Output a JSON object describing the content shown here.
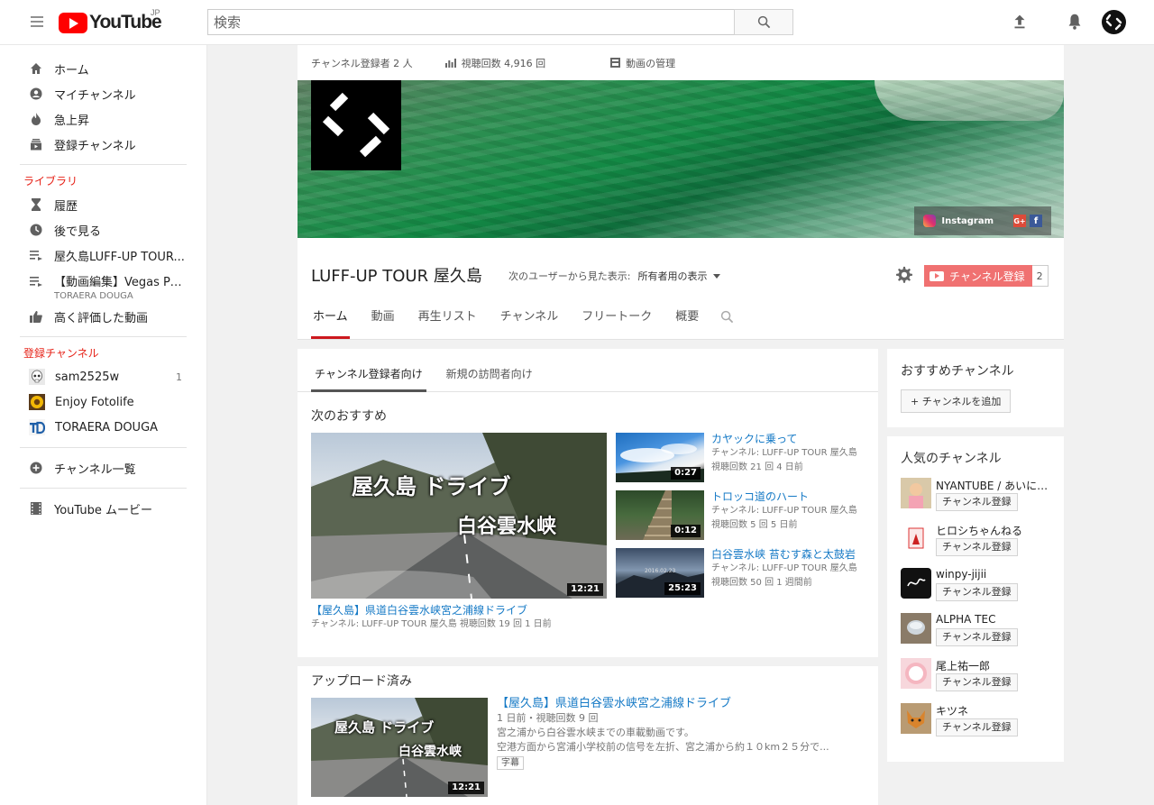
{
  "header": {
    "logo_text": "YouTube",
    "country": "JP",
    "search_placeholder": "検索"
  },
  "sidebar": {
    "main": [
      {
        "label": "ホーム",
        "icon": "home-icon"
      },
      {
        "label": "マイチャンネル",
        "icon": "account-icon"
      },
      {
        "label": "急上昇",
        "icon": "flame-icon"
      },
      {
        "label": "登録チャンネル",
        "icon": "subscriptions-icon"
      }
    ],
    "library_heading": "ライブラリ",
    "library": [
      {
        "label": "履歴",
        "icon": "hourglass-icon"
      },
      {
        "label": "後で見る",
        "icon": "clock-icon"
      },
      {
        "label": "屋久島LUFF-UP TOUR...",
        "icon": "playlist-icon"
      },
      {
        "label": "【動画編集】Vegas Pr...",
        "sub": "TORAERA DOUGA",
        "icon": "playlist-icon"
      },
      {
        "label": "高く評価した動画",
        "icon": "thumbs-up-icon"
      }
    ],
    "subs_heading": "登録チャンネル",
    "subscriptions": [
      {
        "label": "sam2525w",
        "count": "1"
      },
      {
        "label": "Enjoy Fotolife",
        "count": ""
      },
      {
        "label": "TORAERA DOUGA",
        "count": ""
      }
    ],
    "browse_channels": "チャンネル一覧",
    "movies": "YouTube ムービー"
  },
  "channel": {
    "stats": {
      "subscribers": "チャンネル登録者 2 人",
      "views": "視聴回数 4,916 回",
      "manage": "動画の管理"
    },
    "social": {
      "instagram": "Instagram",
      "google": "G+",
      "facebook": "f"
    },
    "title": "LUFF-UP TOUR 屋久島",
    "view_as_label": "次のユーザーから見た表示:",
    "view_as_value": "所有者用の表示",
    "subscribe_label": "チャンネル登録",
    "subscribe_count": "2",
    "tabs": [
      "ホーム",
      "動画",
      "再生リスト",
      "チャンネル",
      "フリートーク",
      "概要"
    ]
  },
  "content": {
    "sub_tabs": [
      "チャンネル登録者向け",
      "新規の訪問者向け"
    ],
    "next_title": "次のおすすめ",
    "featured": {
      "thumb_text_1": "屋久島 ドライブ",
      "thumb_text_2": "白谷雲水峡",
      "duration": "12:21",
      "title": "【屋久島】県道白谷雲水峡宮之浦線ドライブ",
      "meta": "チャンネル: LUFF-UP TOUR 屋久島   視聴回数 19 回   1 日前"
    },
    "side_videos": [
      {
        "title": "カヤックに乗って",
        "channel": "チャンネル: LUFF-UP TOUR 屋久島",
        "meta": "視聴回数 21 回   4 日前",
        "duration": "0:27"
      },
      {
        "title": "トロッコ道のハート",
        "channel": "チャンネル: LUFF-UP TOUR 屋久島",
        "meta": "視聴回数 5 回   5 日前",
        "duration": "0:12"
      },
      {
        "title": "白谷雲水峡 苔むす森と太鼓岩",
        "channel": "チャンネル: LUFF-UP TOUR 屋久島",
        "meta": "視聴回数 50 回   1 週間前",
        "duration": "25:23",
        "thumb_date": "2016.02.23"
      }
    ],
    "uploads_title": "アップロード済み",
    "upload": {
      "thumb_text_1": "屋久島 ドライブ",
      "thumb_text_2": "白谷雲水峡",
      "duration": "12:21",
      "title": "【屋久島】県道白谷雲水峡宮之浦線ドライブ",
      "meta": "1 日前・視聴回数 9 回",
      "desc1": "宮之浦から白谷雲水峡までの車載動画です。",
      "desc2": "空港方面から宮浦小学校前の信号を左折、宮之浦から約１０km２５分で...",
      "badge": "字幕"
    }
  },
  "right": {
    "recommended_title": "おすすめチャンネル",
    "add_channel": "+ チャンネルを追加",
    "popular_title": "人気のチャンネル",
    "subscribe_label": "チャンネル登録",
    "popular": [
      {
        "name": "NYANTUBE / あいにゃん"
      },
      {
        "name": "ヒロシちゃんねる"
      },
      {
        "name": "winpy-jijii"
      },
      {
        "name": "ALPHA TEC"
      },
      {
        "name": "尾上祐一郎"
      },
      {
        "name": "キツネ"
      }
    ]
  }
}
